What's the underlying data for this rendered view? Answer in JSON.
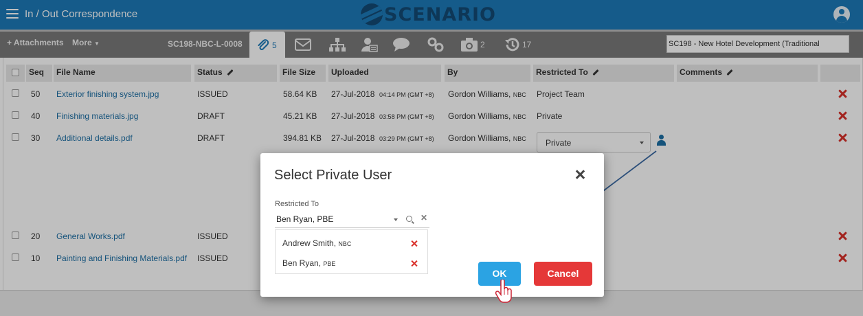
{
  "header": {
    "app_title": "In / Out Correspondence",
    "logo_text": "SCENARIO"
  },
  "toolbar": {
    "attachments_label": "+ Attachments",
    "more_label": "More",
    "doc_ref": "SC198-NBC-L-0008",
    "tabs": [
      {
        "icon": "paperclip-icon",
        "count": "5"
      },
      {
        "icon": "envelope-icon",
        "count": ""
      },
      {
        "icon": "org-chart-icon",
        "count": ""
      },
      {
        "icon": "user-card-icon",
        "count": ""
      },
      {
        "icon": "speech-bubble-icon",
        "count": ""
      },
      {
        "icon": "link-icon",
        "count": ""
      },
      {
        "icon": "camera-icon",
        "count": "2"
      },
      {
        "icon": "history-icon",
        "count": "17"
      }
    ],
    "project": "SC198  -  New Hotel Development (Traditional"
  },
  "table": {
    "columns": [
      "Seq",
      "File Name",
      "Status",
      "File Size",
      "Uploaded",
      "By",
      "Restricted To",
      "Comments"
    ],
    "rows": [
      {
        "seq": "50",
        "file": "Exterior finishing system.jpg",
        "status": "ISSUED",
        "size": "58.64 KB",
        "date": "27-Jul-2018",
        "time": "04:14 PM (GMT +8)",
        "by": "Gordon Williams,",
        "org": "NBC",
        "restricted": "Project Team"
      },
      {
        "seq": "40",
        "file": "Finishing materials.jpg",
        "status": "DRAFT",
        "size": "45.21 KB",
        "date": "27-Jul-2018",
        "time": "03:58 PM (GMT +8)",
        "by": "Gordon Williams,",
        "org": "NBC",
        "restricted": "Private"
      },
      {
        "seq": "30",
        "file": "Additional details.pdf",
        "status": "DRAFT",
        "size": "394.81 KB",
        "date": "27-Jul-2018",
        "time": "03:29 PM (GMT +8)",
        "by": "Gordon Williams,",
        "org": "NBC",
        "restricted": "Private"
      },
      {
        "seq": "20",
        "file": "General Works.pdf",
        "status": "ISSUED"
      },
      {
        "seq": "10",
        "file": "Painting and Finishing Materials.pdf",
        "status": "ISSUED"
      }
    ]
  },
  "modal": {
    "title": "Select Private User",
    "field_label": "Restricted To",
    "picker_value": "Ben Ryan, PBE",
    "selected": [
      {
        "name": "Andrew Smith,",
        "org": "NBC"
      },
      {
        "name": "Ben Ryan,",
        "org": "PBE"
      }
    ],
    "ok_label": "OK",
    "cancel_label": "Cancel"
  }
}
